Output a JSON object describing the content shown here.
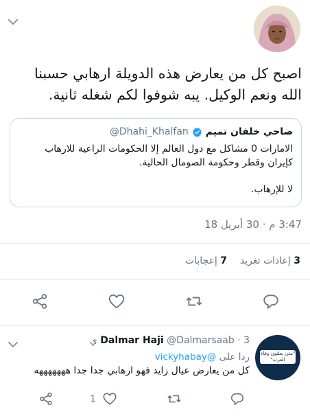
{
  "tweet": {
    "text": "اصبح كل من يعارض هذه الدويلة ارهابي حسبنا الله ونعم الوكيل. يبه شوفوا لكم شغله ثانية.",
    "time": "3:47 م · 30 أبريل 18",
    "retweets_count": "3",
    "retweets_label": "إعادات تغريد",
    "likes_count": "7",
    "likes_label": "إعجابات"
  },
  "quote": {
    "name": "ضاحي خلفان تميم",
    "handle": "@Dhahi_Khalfan",
    "body": "الامارات 0 مشاكل مع دول العالم إلا الحكومات الراعية للارهاب كإيران وقطر وحكومة الصومال الحالية.",
    "footer": "لا للإرهاب."
  },
  "reply": {
    "name": "Dalmar Haji",
    "handle": "@Dalmarsaab",
    "time": "· 3 ي",
    "reply_to_label": "ردا على",
    "reply_to_handle": "@vickyhabay",
    "text": "كل من يعارض عيال زايد فهو ارهابي جدا جدا هههههههه",
    "likes": "1",
    "avatar_text": "\"متى يعلنون وفاة العرب\""
  },
  "colors": {
    "accent": "#1da1f2",
    "muted": "#657786",
    "divider": "#e6ecf0",
    "text": "#14171a"
  },
  "icons": [
    "chevron-down-icon",
    "verified-badge-icon",
    "share-icon",
    "heart-icon",
    "retweet-icon",
    "reply-icon"
  ]
}
